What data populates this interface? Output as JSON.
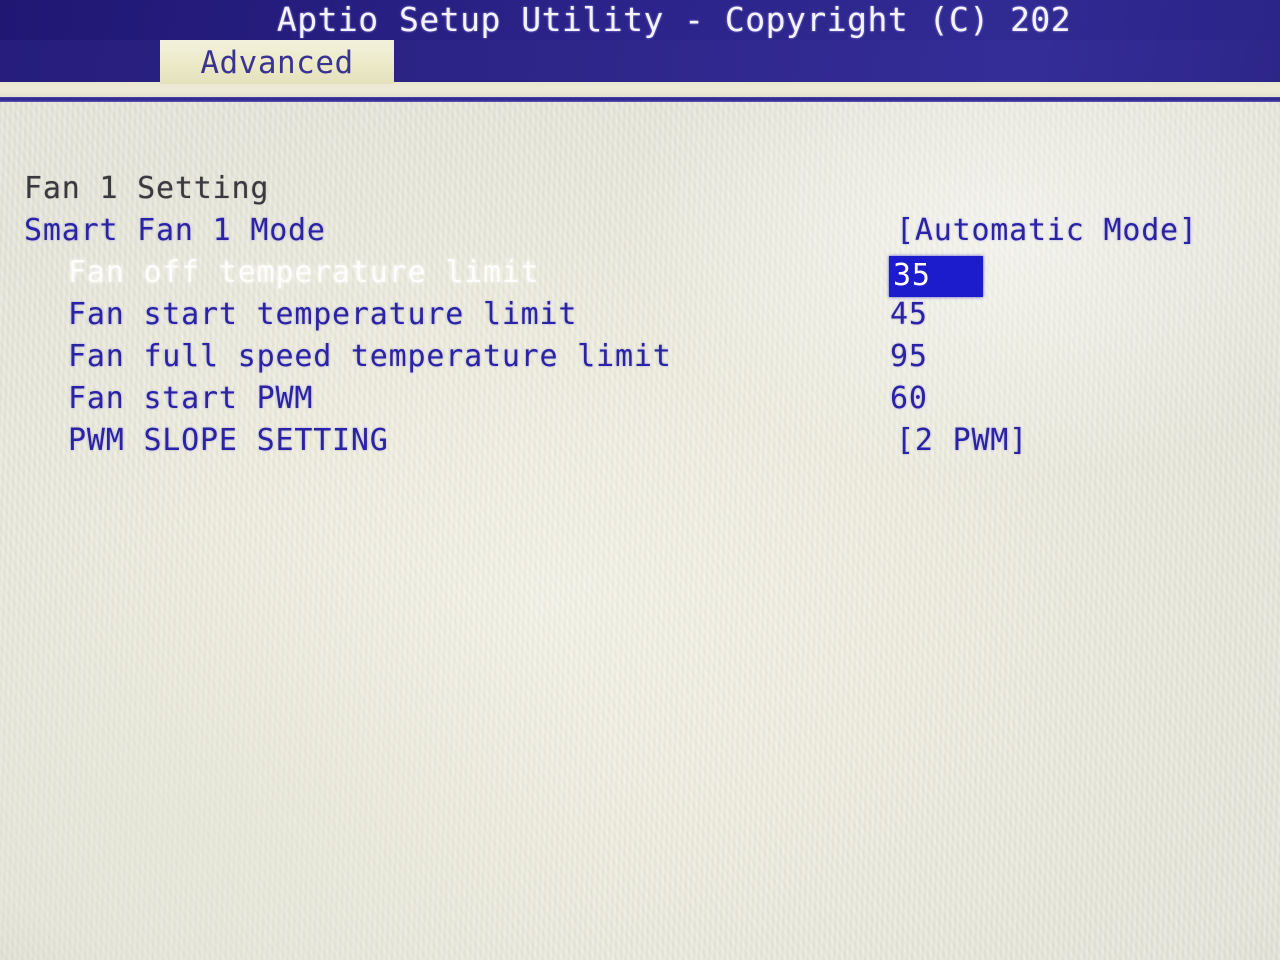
{
  "header": {
    "title": "Aptio Setup Utility - Copyright (C) 202",
    "bar_color": "#2a2287"
  },
  "tabs": {
    "active": "Advanced",
    "items": [
      {
        "label": "Advanced",
        "active": true
      }
    ]
  },
  "colors": {
    "screen_background": "#eceade",
    "header_blue": "#2a2287",
    "item_text": "#2b23a3",
    "section_header_text": "#3a3a3e",
    "selected_row_text": "#fdfdfb",
    "highlight_background": "#1c1ccc",
    "highlight_text": "#ffffff",
    "tab_background": "#eceac7",
    "tab_text": "#3b3392"
  },
  "main": {
    "section_title": "Fan 1 Setting",
    "rows": [
      {
        "label": "Fan 1 Setting",
        "value": "",
        "style": "section-header",
        "indent": 0,
        "selected": false,
        "value_highlighted": false
      },
      {
        "label": "Smart Fan 1 Mode",
        "value": "[Automatic Mode]",
        "style": "item",
        "indent": 0,
        "selected": false,
        "value_highlighted": false
      },
      {
        "label": "Fan off temperature limit",
        "value": "35",
        "style": "item",
        "indent": 1,
        "selected": true,
        "value_highlighted": true
      },
      {
        "label": "Fan start temperature limit",
        "value": "45",
        "style": "item",
        "indent": 1,
        "selected": false,
        "value_highlighted": false
      },
      {
        "label": "Fan full speed temperature limit",
        "value": "95",
        "style": "item",
        "indent": 1,
        "selected": false,
        "value_highlighted": false
      },
      {
        "label": "Fan start PWM",
        "value": "60",
        "style": "item",
        "indent": 1,
        "selected": false,
        "value_highlighted": false
      },
      {
        "label": "PWM SLOPE SETTING",
        "value": "[2 PWM]",
        "style": "item",
        "indent": 1,
        "selected": false,
        "value_highlighted": false
      }
    ]
  }
}
